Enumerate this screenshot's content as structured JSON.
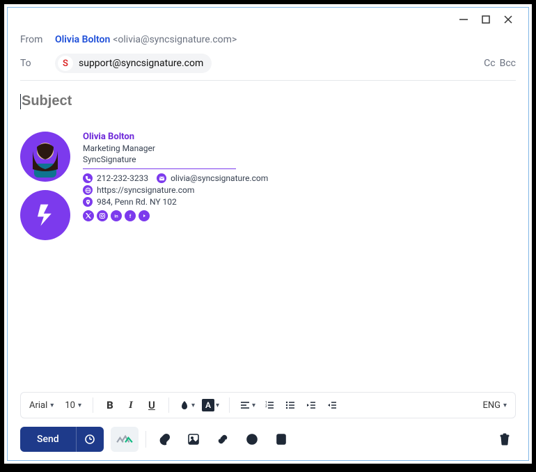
{
  "window": {
    "min": "−",
    "max": "▢",
    "close": "✕"
  },
  "from": {
    "label": "From",
    "name": "Olivia Bolton",
    "email": "<olivia@syncsignature.com>"
  },
  "to": {
    "label": "To",
    "chip_initial": "S",
    "chip_email": "support@syncsignature.com",
    "cc": "Cc",
    "bcc": "Bcc"
  },
  "subject": {
    "placeholder": "Subject"
  },
  "signature": {
    "name": "Olivia Bolton",
    "title": "Marketing Manager",
    "company": "SyncSignature",
    "phone": "212-232-3233",
    "email": "olivia@syncsignature.com",
    "url": "https://syncsignature.com",
    "address": "984, Penn Rd. NY 102"
  },
  "toolbar": {
    "font": "Arial",
    "size": "10",
    "lang": "ENG"
  },
  "actions": {
    "send": "Send"
  }
}
